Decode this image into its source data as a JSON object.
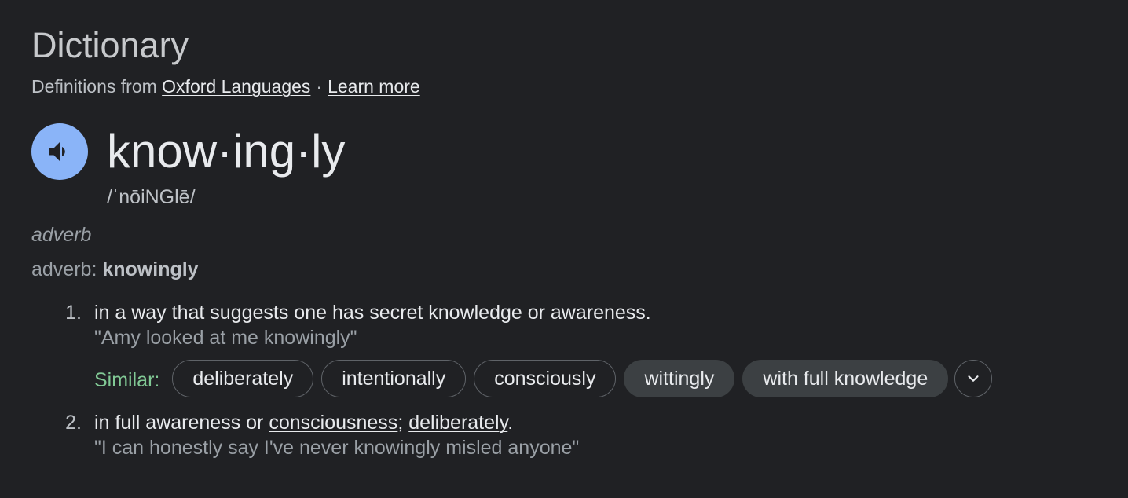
{
  "header": {
    "title": "Dictionary",
    "source_prefix": "Definitions from",
    "source_link": "Oxford Languages",
    "separator": "·",
    "learn_more": "Learn more"
  },
  "entry": {
    "headword": "know·ing·ly",
    "phonetic": "/ˈnōiNGlē/",
    "speaker_icon": "speaker-icon",
    "part_of_speech": "adverb",
    "pos_label": "adverb",
    "pos_colon": ": ",
    "pos_word": "knowingly"
  },
  "senses": [
    {
      "number": "1.",
      "definition": "in a way that suggests one has secret knowledge or awareness.",
      "example": "\"Amy looked at me knowingly\"",
      "similar_label": "Similar:",
      "similar": [
        {
          "label": "deliberately",
          "style": "outline"
        },
        {
          "label": "intentionally",
          "style": "outline"
        },
        {
          "label": "consciously",
          "style": "outline"
        },
        {
          "label": "wittingly",
          "style": "filled"
        },
        {
          "label": "with full knowledge",
          "style": "filled"
        }
      ],
      "expand_icon": "chevron-down-icon"
    },
    {
      "number": "2.",
      "definition_prefix": "in full awareness or ",
      "definition_link1": "consciousness",
      "definition_middle": "; ",
      "definition_link2": "deliberately",
      "definition_suffix": ".",
      "example": "\"I can honestly say I've never knowingly misled anyone\""
    }
  ],
  "colors": {
    "background": "#202124",
    "speaker_button": "#8ab4f8",
    "similar_label": "#81c995",
    "text_primary": "#e8eaed",
    "text_secondary": "#9aa0a6"
  }
}
